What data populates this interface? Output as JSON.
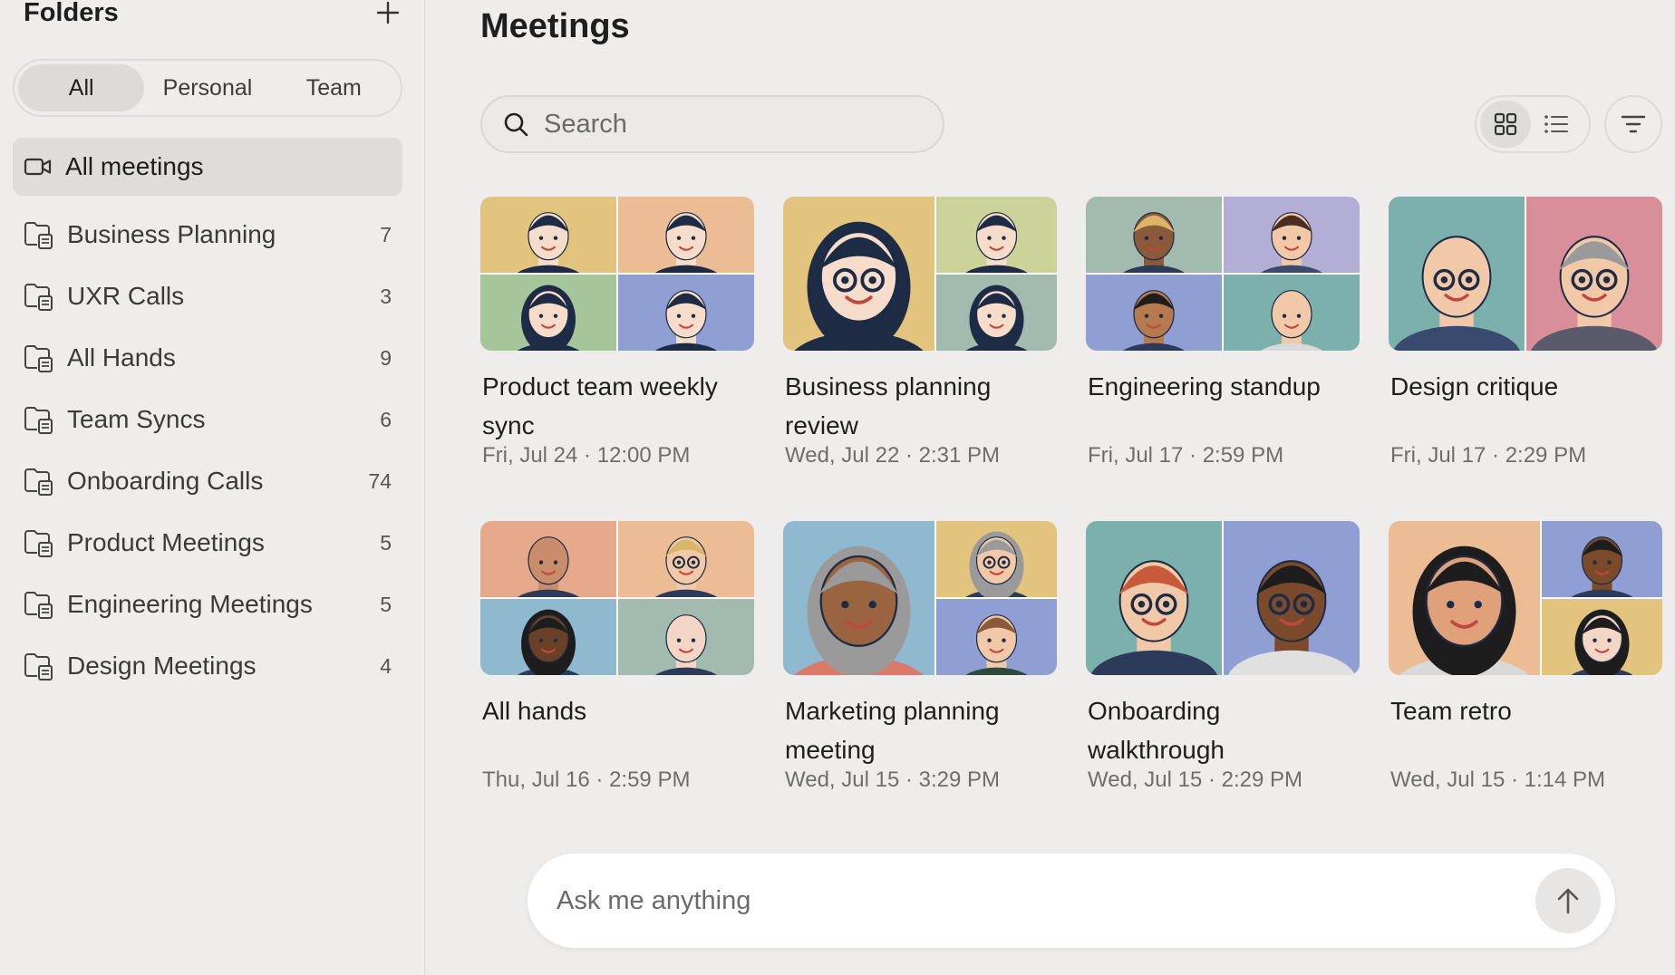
{
  "sidebar": {
    "title": "Folders",
    "segments": [
      "All",
      "Personal",
      "Team"
    ],
    "active_segment": "All",
    "all_meetings_label": "All meetings",
    "folders": [
      {
        "name": "Business Planning",
        "count": "7"
      },
      {
        "name": "UXR Calls",
        "count": "3"
      },
      {
        "name": "All Hands",
        "count": "9"
      },
      {
        "name": "Team Syncs",
        "count": "6"
      },
      {
        "name": "Onboarding Calls",
        "count": "74"
      },
      {
        "name": "Product Meetings",
        "count": "5"
      },
      {
        "name": "Engineering Meetings",
        "count": "5"
      },
      {
        "name": "Design Meetings",
        "count": "4"
      }
    ]
  },
  "main": {
    "title": "Meetings",
    "search_placeholder": "Search",
    "view_mode": "grid",
    "meetings": [
      {
        "title": "Product team weekly sync",
        "date": "Fri, Jul 24 · 12:00 PM"
      },
      {
        "title": "Business planning review",
        "date": "Wed, Jul 22 · 2:31 PM"
      },
      {
        "title": "Engineering standup",
        "date": "Fri, Jul 17 · 2:59 PM"
      },
      {
        "title": "Design critique",
        "date": "Fri, Jul 17 · 2:29 PM"
      },
      {
        "title": "All hands",
        "date": "Thu, Jul 16 · 2:59 PM"
      },
      {
        "title": "Marketing planning meeting",
        "date": "Wed, Jul 15 · 3:29 PM"
      },
      {
        "title": "Onboarding walkthrough",
        "date": "Wed, Jul 15 · 2:29 PM"
      },
      {
        "title": "Team retro",
        "date": "Wed, Jul 15 · 1:14 PM"
      }
    ]
  },
  "ask": {
    "placeholder": "Ask me anything"
  },
  "colors": {
    "background": "#eeedeb",
    "active_pill": "#dcdbd8",
    "thumb_yellow": "#e3c47f",
    "thumb_peach": "#ecbc95",
    "thumb_green": "#a5c69a",
    "thumb_blue": "#8f9fd3",
    "thumb_teal": "#7bb0ad",
    "thumb_pink": "#d98f99",
    "thumb_sage": "#a3bbae",
    "thumb_lavender": "#b2aed6"
  }
}
